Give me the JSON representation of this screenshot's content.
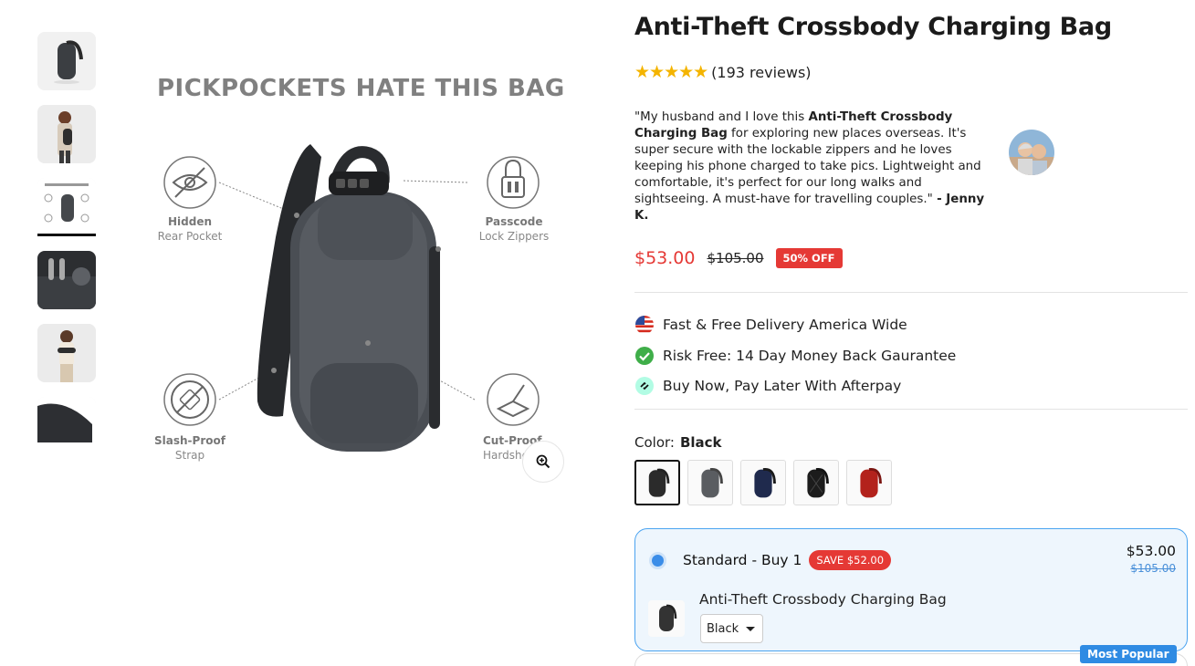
{
  "product": {
    "title": "Anti-Theft Crossbody Charging Bag",
    "rating_stars": 5,
    "reviews_text": "(193 reviews)"
  },
  "gallery": {
    "thumbnails": [
      "bag-front",
      "model-wearing-bag",
      "pickpockets-infographic",
      "lock-zipper-closeup",
      "model-holding-bag",
      "bag-side"
    ],
    "active_index": 2,
    "headline": "PICKPOCKETS HATE THIS BAG",
    "features": {
      "hidden": {
        "line1": "Hidden",
        "line2": "Rear Pocket"
      },
      "passcode": {
        "line1": "Passcode",
        "line2": "Lock Zippers"
      },
      "slash": {
        "line1": "Slash-Proof",
        "line2": "Strap"
      },
      "cut": {
        "line1": "Cut-Proof",
        "line2": "Hardshell"
      }
    }
  },
  "testimonial": {
    "part1": "\"My husband and I love this ",
    "bold": "Anti-Theft Crossbody Charging Bag",
    "part2": " for exploring new places overseas. It's super secure with the lockable zippers and he loves keeping his phone charged to take pics. Lightweight and comfortable, it's perfect for our long walks and sightseeing. A must-have for travelling couples.\" ",
    "author": "- Jenny K."
  },
  "pricing": {
    "current": "$53.00",
    "original": "$105.00",
    "discount_badge": "50% OFF"
  },
  "benefits": [
    {
      "icon": "us-flag-icon",
      "text": "Fast & Free Delivery America Wide"
    },
    {
      "icon": "check-circle-icon",
      "text": "Risk Free: 14 Day Money Back Gaurantee"
    },
    {
      "icon": "afterpay-icon",
      "text": "Buy Now, Pay Later With Afterpay"
    }
  ],
  "color": {
    "label": "Color:",
    "selected": "Black",
    "swatches": [
      "Black",
      "Grey",
      "Navy",
      "Black Pattern",
      "Red"
    ],
    "swatch_colors": [
      "#2b2b2b",
      "#5a5d61",
      "#1f2a4d",
      "#1c1c1c",
      "#b3221c"
    ]
  },
  "bundle": {
    "title": "Standard - Buy 1",
    "save_badge": "SAVE $52.00",
    "price": "$53.00",
    "old_price": "$105.00",
    "item_name": "Anti-Theft Crossbody Charging Bag",
    "variant": "Black",
    "popular_badge": "Most Popular"
  },
  "colors": {
    "accent_red": "#e53935",
    "accent_blue": "#2f8be3",
    "star": "#f4b400"
  }
}
